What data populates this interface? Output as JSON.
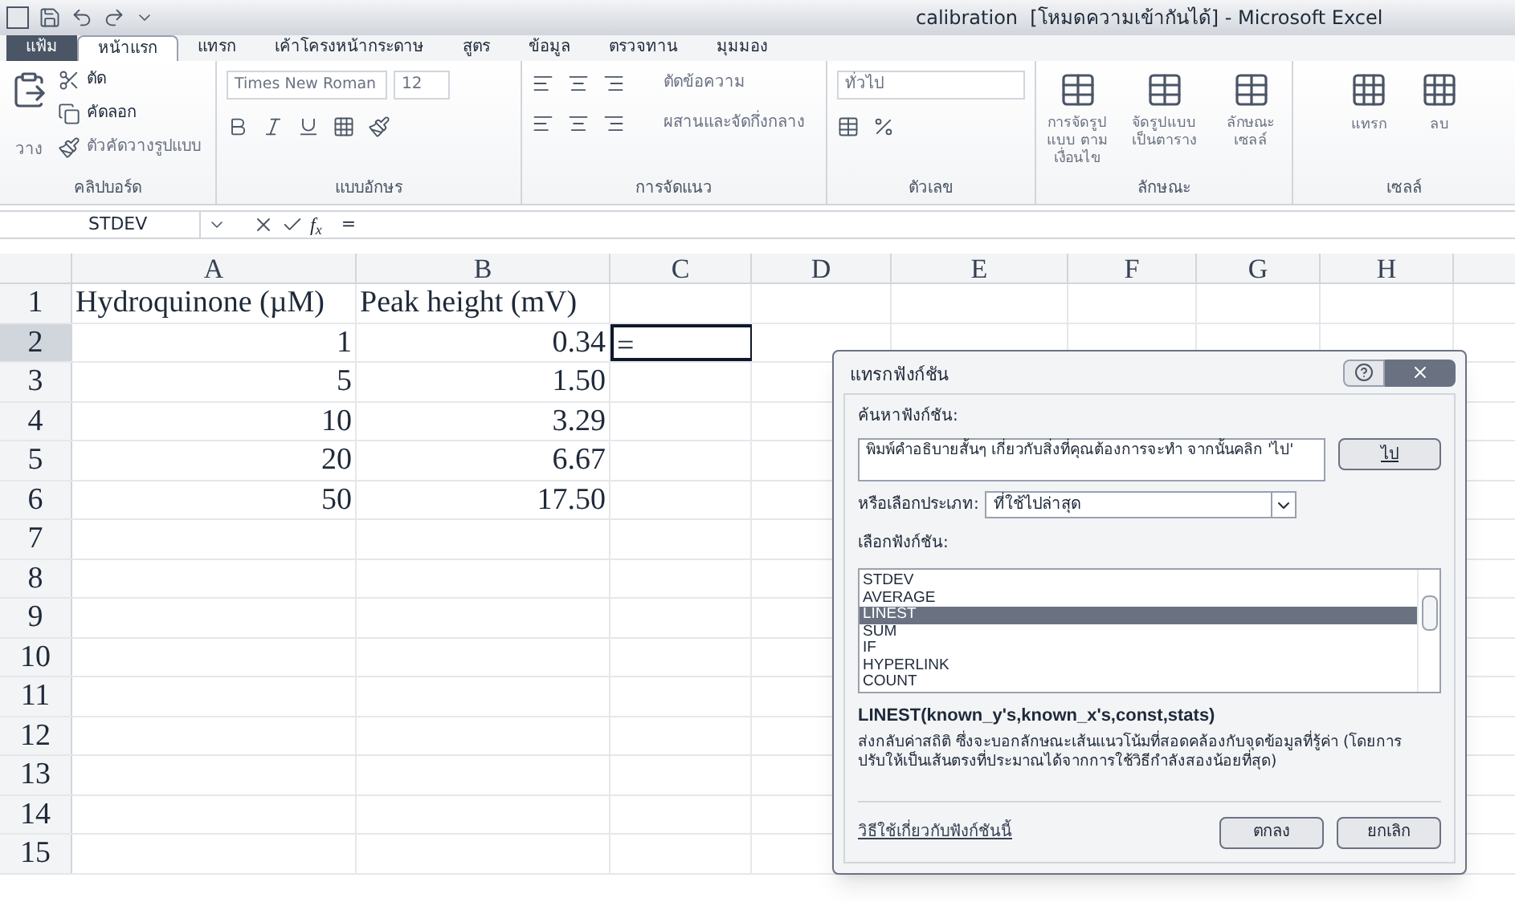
{
  "window": {
    "title": "calibration  [โหมดความเข้ากันได้] - Microsoft Excel"
  },
  "ribbon_tabs": [
    {
      "label": "แฟ้ม",
      "kind": "file",
      "selected": false
    },
    {
      "label": "หน้าแรก",
      "kind": "tab",
      "selected": true
    },
    {
      "label": "แทรก",
      "kind": "tab",
      "selected": false
    },
    {
      "label": "เค้าโครงหน้ากระดาษ",
      "kind": "tab",
      "selected": false
    },
    {
      "label": "สูตร",
      "kind": "tab",
      "selected": false
    },
    {
      "label": "ข้อมูล",
      "kind": "tab",
      "selected": false
    },
    {
      "label": "ตรวจทาน",
      "kind": "tab",
      "selected": false
    },
    {
      "label": "มุมมอง",
      "kind": "tab",
      "selected": false
    }
  ],
  "clipboard": {
    "paste": "วาง",
    "cut": "ตัด",
    "copy": "คัดลอก",
    "format_painter": "ตัวคัดวางรูปแบบ",
    "label": "คลิปบอร์ด"
  },
  "font": {
    "name": "Times New Roman",
    "size": "12",
    "label": "แบบอักษร"
  },
  "alignment": {
    "wrap": "ตัดข้อความ",
    "merge": "ผสานและจัดกึ่งกลาง",
    "label": "การจัดแนว"
  },
  "number": {
    "format": "ทั่วไป",
    "label": "ตัวเลข"
  },
  "styles": {
    "items": [
      "การจัดรูปแบบ ตามเงื่อนไข",
      "จัดรูปแบบ เป็นตาราง",
      "ลักษณะ เซลล์"
    ],
    "label": "ลักษณะ"
  },
  "cells": {
    "items": [
      "แทรก",
      "ลบ"
    ],
    "label": "เซลล์"
  },
  "formula_bar": {
    "name_box": "STDEV",
    "fx": "f$_{x}$",
    "formula": "="
  },
  "sheet": {
    "columns": [
      "A",
      "B",
      "C",
      "D",
      "E",
      "F",
      "G",
      "H"
    ],
    "rows": [
      {
        "header": "1",
        "cells": [
          {
            "text": "Hydroquinone (µM)",
            "kind": "text"
          },
          {
            "text": "Peak height (mV)",
            "kind": "text"
          }
        ]
      },
      {
        "header": "2",
        "selected": true,
        "cells": [
          {
            "text": "1",
            "kind": "number"
          },
          {
            "text": "0.34",
            "kind": "number"
          },
          {
            "text": "=",
            "kind": "text",
            "active": true
          }
        ]
      },
      {
        "header": "3",
        "cells": [
          {
            "text": "5",
            "kind": "number"
          },
          {
            "text": "1.50",
            "kind": "number"
          }
        ]
      },
      {
        "header": "4",
        "cells": [
          {
            "text": "10",
            "kind": "number"
          },
          {
            "text": "3.29",
            "kind": "number"
          }
        ]
      },
      {
        "header": "5",
        "cells": [
          {
            "text": "20",
            "kind": "number"
          },
          {
            "text": "6.67",
            "kind": "number"
          }
        ]
      },
      {
        "header": "6",
        "cells": [
          {
            "text": "50",
            "kind": "number"
          },
          {
            "text": "17.50",
            "kind": "number"
          }
        ]
      },
      {
        "header": "7",
        "cells": []
      },
      {
        "header": "8",
        "cells": []
      },
      {
        "header": "9",
        "cells": []
      },
      {
        "header": "10",
        "cells": []
      },
      {
        "header": "11",
        "cells": []
      },
      {
        "header": "12",
        "cells": []
      },
      {
        "header": "13",
        "cells": []
      },
      {
        "header": "14",
        "cells": []
      },
      {
        "header": "15",
        "cells": []
      }
    ]
  },
  "dialog": {
    "title": "แทรกฟังก์ชัน",
    "search_label": "ค้นหาฟังก์ชัน:",
    "search_value": "พิมพ์คำอธิบายสั้นๆ เกี่ยวกับสิ่งที่คุณต้องการจะทำ จากนั้นคลิก 'ไป'",
    "go_button": "ไป",
    "category_label": "หรือเลือกประเภท:",
    "category": "ที่ใช้ไปล่าสุด",
    "function_label": "เลือกฟังก์ชัน:",
    "functions": [
      {
        "name": "STDEV",
        "selected": false
      },
      {
        "name": "AVERAGE",
        "selected": false
      },
      {
        "name": "LINEST",
        "selected": true
      },
      {
        "name": "SUM",
        "selected": false
      },
      {
        "name": "IF",
        "selected": false
      },
      {
        "name": "HYPERLINK",
        "selected": false
      },
      {
        "name": "COUNT",
        "selected": false
      }
    ],
    "signature": "LINEST(known_y's,known_x's,const,stats)",
    "description": "ส่งกลับค่าสถิติ ซึ่งจะบอกลักษณะเส้นแนวโน้มที่สอดคล้องกับจุดข้อมูลที่รู้ค่า (โดยการปรับให้เป็นเส้นตรงที่ประมาณได้จากการใช้วิธีกำลังสองน้อยที่สุด)",
    "help_link": "วิธีใช้เกี่ยวกับฟังก์ชันนี้",
    "buttons": [
      "ตกลง",
      "ยกเลิก"
    ]
  }
}
